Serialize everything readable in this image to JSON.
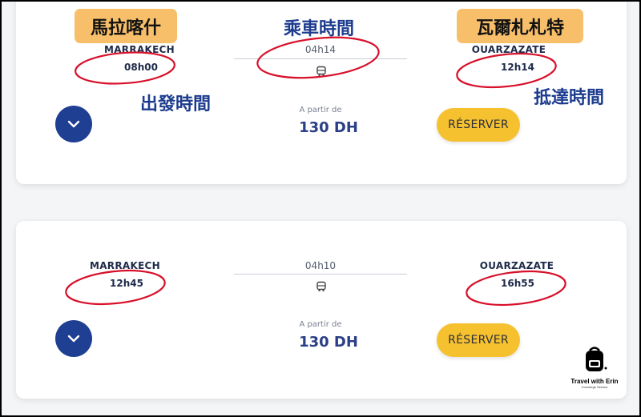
{
  "trips": [
    {
      "departure_city": "MARRAKECH",
      "departure_time": "08h00",
      "duration": "04h14",
      "arrival_city": "OUARZAZATE",
      "arrival_time": "12h14",
      "price_label": "A partir de",
      "price": "130 DH",
      "reserve_label": "RÉSERVER"
    },
    {
      "departure_city": "MARRAKECH",
      "departure_time": "12h45",
      "duration": "04h10",
      "arrival_city": "OUARZAZATE",
      "arrival_time": "16h55",
      "price_label": "A partir de",
      "price": "130 DH",
      "reserve_label": "RÉSERVER"
    }
  ],
  "annotations": {
    "departure_city_tag": "馬拉喀什",
    "duration_label": "乘車時間",
    "arrival_city_tag": "瓦爾札札特",
    "departure_time_label": "出發時間",
    "arrival_time_label": "抵達時間"
  },
  "watermark": {
    "title": "Travel with Erin",
    "subtitle": "Concierge Service"
  },
  "colors": {
    "accent_blue": "#1f3f93",
    "price_blue": "#2b3f86",
    "reserve_yellow": "#f6c12f",
    "annotation_red": "#d8102a",
    "tag_orange": "#f8bf6b"
  },
  "icons": [
    "bus-icon",
    "chevron-down-icon",
    "backpack-logo-icon"
  ]
}
